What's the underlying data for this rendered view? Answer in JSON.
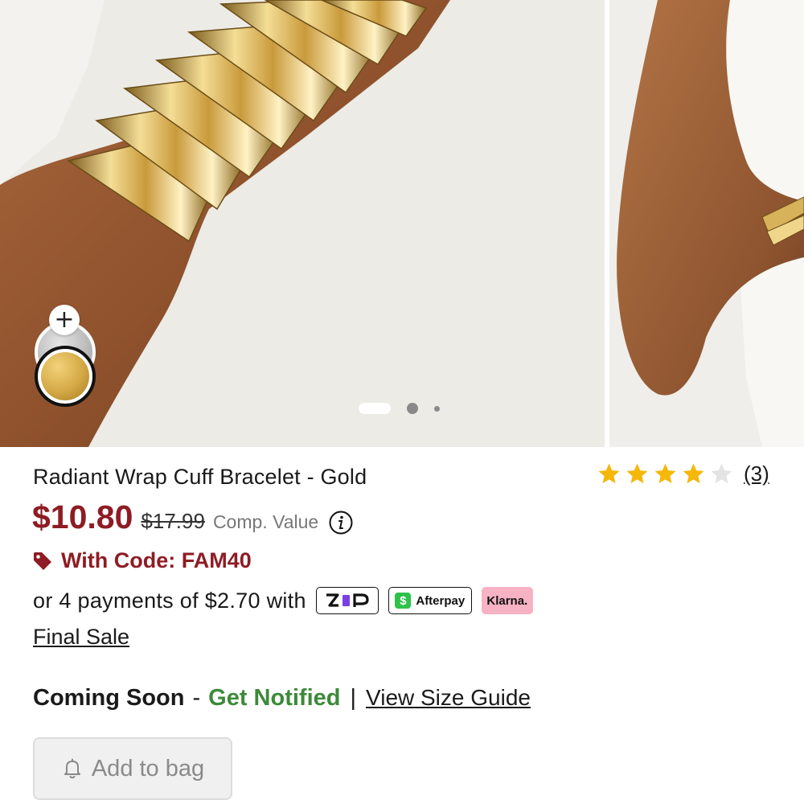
{
  "gallery": {
    "images": [
      "product-image-main",
      "product-image-next"
    ],
    "active_index": 0,
    "swatches": [
      {
        "name": "silver",
        "color": "#b9b9b9",
        "selected": false
      },
      {
        "name": "gold",
        "color": "#d4a845",
        "selected": true
      }
    ],
    "add_swatch_label": "+"
  },
  "product": {
    "title": "Radiant Wrap Cuff Bracelet - Gold",
    "rating": 4,
    "rating_max": 5,
    "review_count": "(3)",
    "price_now": "$10.80",
    "price_was": "$17.99",
    "comp_label": "Comp. Value",
    "promo_code": "With Code: FAM40",
    "installments": "or 4 payments of $2.70 with",
    "final_sale": "Final Sale"
  },
  "payment_badges": {
    "zip": "zip",
    "afterpay": "Afterpay",
    "klarna": "Klarna."
  },
  "availability": {
    "status": "Coming Soon",
    "dash": "-",
    "notify": "Get Notified",
    "divider": "|",
    "size_guide": "View Size Guide"
  },
  "cta": {
    "add_to_bag": "Add to bag"
  },
  "colors": {
    "sale_red": "#8e1c24",
    "notify_green": "#3c8a3a",
    "star_gold": "#f5b70a",
    "star_empty": "#e3e3e3",
    "zip_purple": "#7b3fe4",
    "afterpay_green": "#2ec24a",
    "klarna_pink": "#f7b2c3"
  }
}
